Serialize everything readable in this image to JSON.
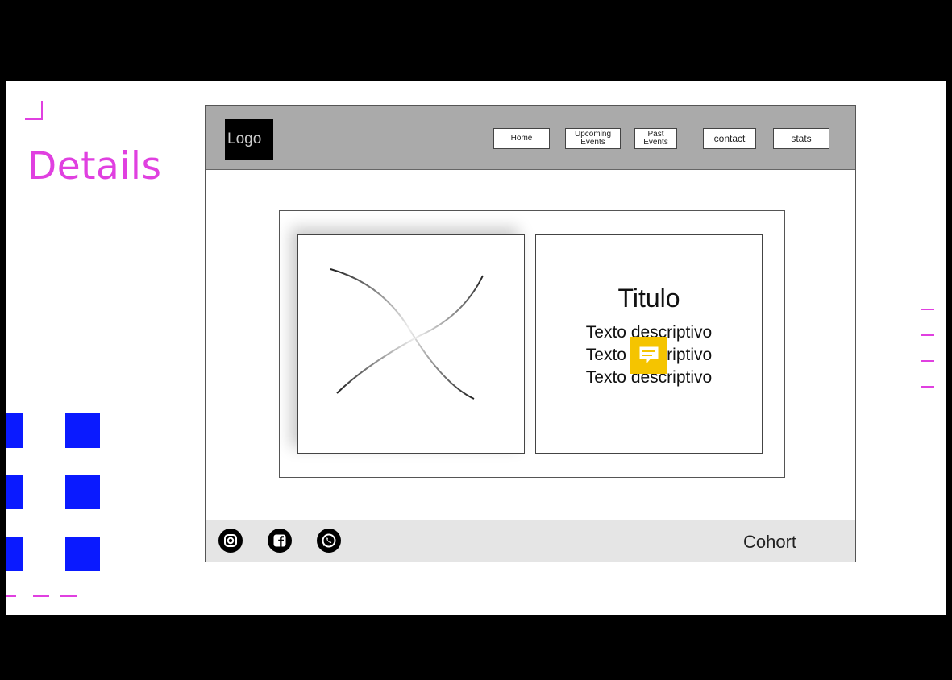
{
  "slide": {
    "heading": "Details"
  },
  "mock": {
    "logo": "Logo",
    "nav": [
      "Home",
      "Upcoming Events",
      "Past Events",
      "contact",
      "stats"
    ],
    "card": {
      "title": "Titulo",
      "description_lines": [
        "Texto descriptivo",
        "Texto descriptivo",
        "Texto descriptivo"
      ]
    },
    "footer": {
      "social_icons": [
        "instagram-icon",
        "facebook-icon",
        "whatsapp-icon"
      ],
      "brand": "Cohort"
    }
  },
  "colors": {
    "accent_pink": "#e040e0",
    "accent_blue": "#0a1aff",
    "comment_yellow": "#f5c400",
    "header_gray": "#aaaaaa",
    "footer_gray": "#e5e5e5"
  }
}
